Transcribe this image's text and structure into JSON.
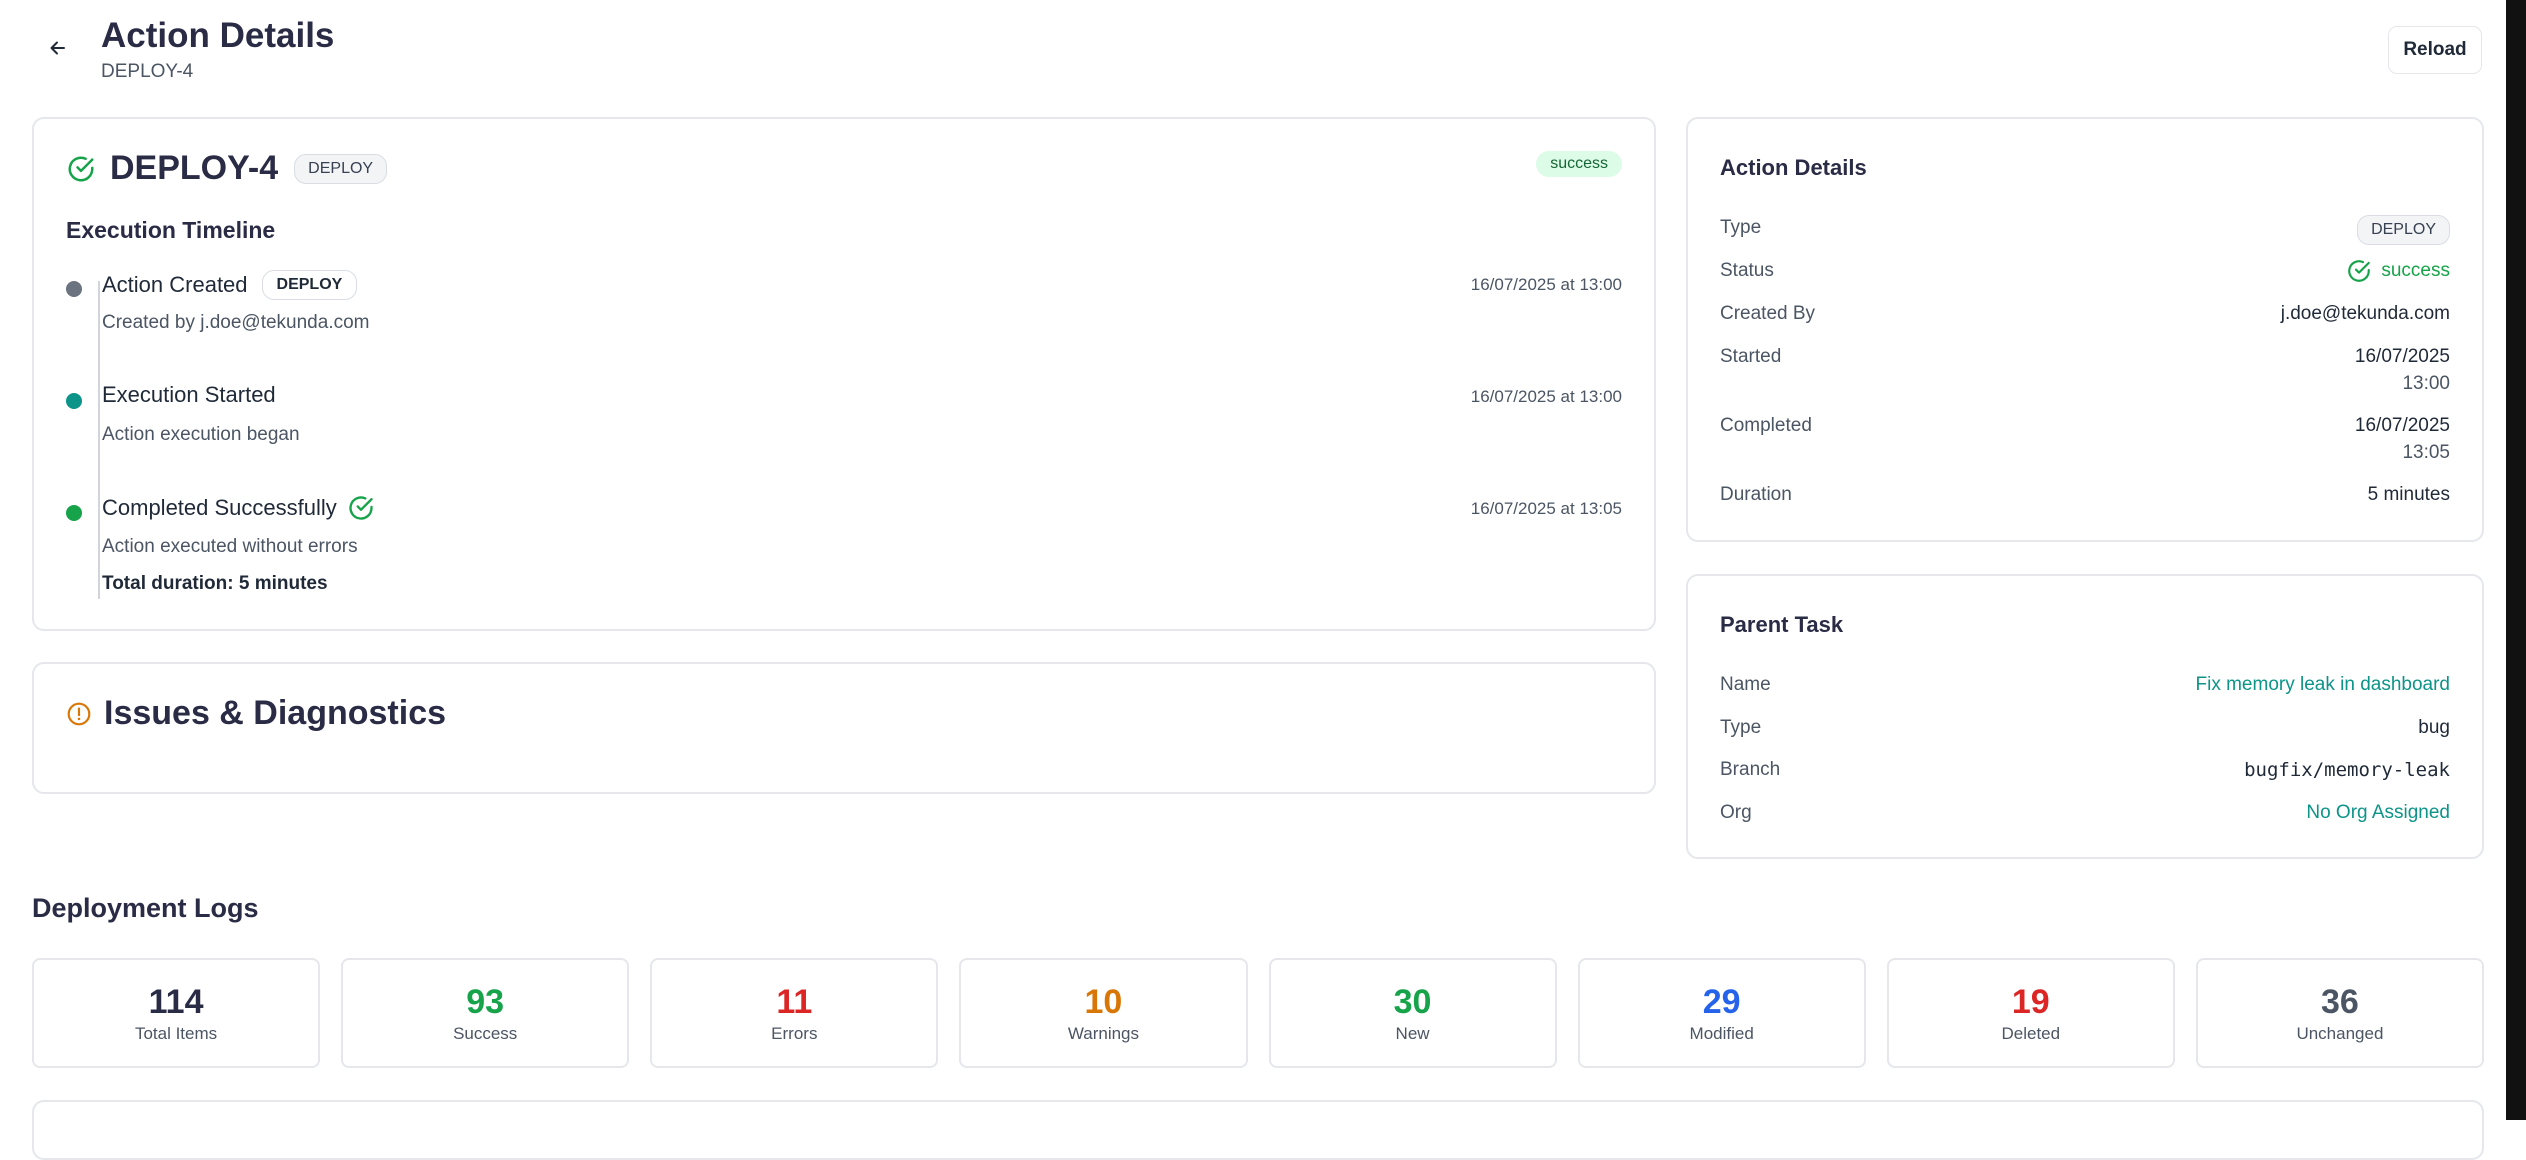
{
  "header": {
    "title": "Action Details",
    "subtitle": "DEPLOY-4",
    "reload_label": "Reload"
  },
  "action": {
    "name": "DEPLOY-4",
    "type_tag": "DEPLOY",
    "status": "success",
    "timeline_title": "Execution Timeline",
    "timeline": [
      {
        "title": "Action Created",
        "tag": "DEPLOY",
        "time": "16/07/2025 at 13:00",
        "description": "Created by j.doe@tekunda.com"
      },
      {
        "title": "Execution Started",
        "time": "16/07/2025 at 13:00",
        "description": "Action execution began"
      },
      {
        "title": "Completed Successfully",
        "time": "16/07/2025 at 13:05",
        "description": "Action executed without errors",
        "total": "Total duration: 5 minutes"
      }
    ]
  },
  "issues": {
    "title": "Issues & Diagnostics"
  },
  "details": {
    "title": "Action Details",
    "type_label": "Type",
    "type_value": "DEPLOY",
    "status_label": "Status",
    "status_value": "success",
    "created_by_label": "Created By",
    "created_by_value": "j.doe@tekunda.com",
    "started_label": "Started",
    "started_date": "16/07/2025",
    "started_time": "13:00",
    "completed_label": "Completed",
    "completed_date": "16/07/2025",
    "completed_time": "13:05",
    "duration_label": "Duration",
    "duration_value": "5 minutes"
  },
  "parent_task": {
    "title": "Parent Task",
    "name_label": "Name",
    "name_value": "Fix memory leak in dashboard",
    "type_label": "Type",
    "type_value": "bug",
    "branch_label": "Branch",
    "branch_value": "bugfix/memory-leak",
    "org_label": "Org",
    "org_value": "No Org Assigned"
  },
  "logs": {
    "title": "Deployment Logs",
    "stats": [
      {
        "value": "114",
        "label": "Total Items",
        "color": "#2a2b45"
      },
      {
        "value": "93",
        "label": "Success",
        "color": "#16a34a"
      },
      {
        "value": "11",
        "label": "Errors",
        "color": "#dc2626"
      },
      {
        "value": "10",
        "label": "Warnings",
        "color": "#d97706"
      },
      {
        "value": "30",
        "label": "New",
        "color": "#16a34a"
      },
      {
        "value": "29",
        "label": "Modified",
        "color": "#2563eb"
      },
      {
        "value": "19",
        "label": "Deleted",
        "color": "#dc2626"
      },
      {
        "value": "36",
        "label": "Unchanged",
        "color": "#4b5563"
      }
    ]
  },
  "colors": {
    "success": "#16a34a",
    "teal": "#0d9488",
    "warning": "#d97706",
    "gray_dot": "#6b7280"
  }
}
